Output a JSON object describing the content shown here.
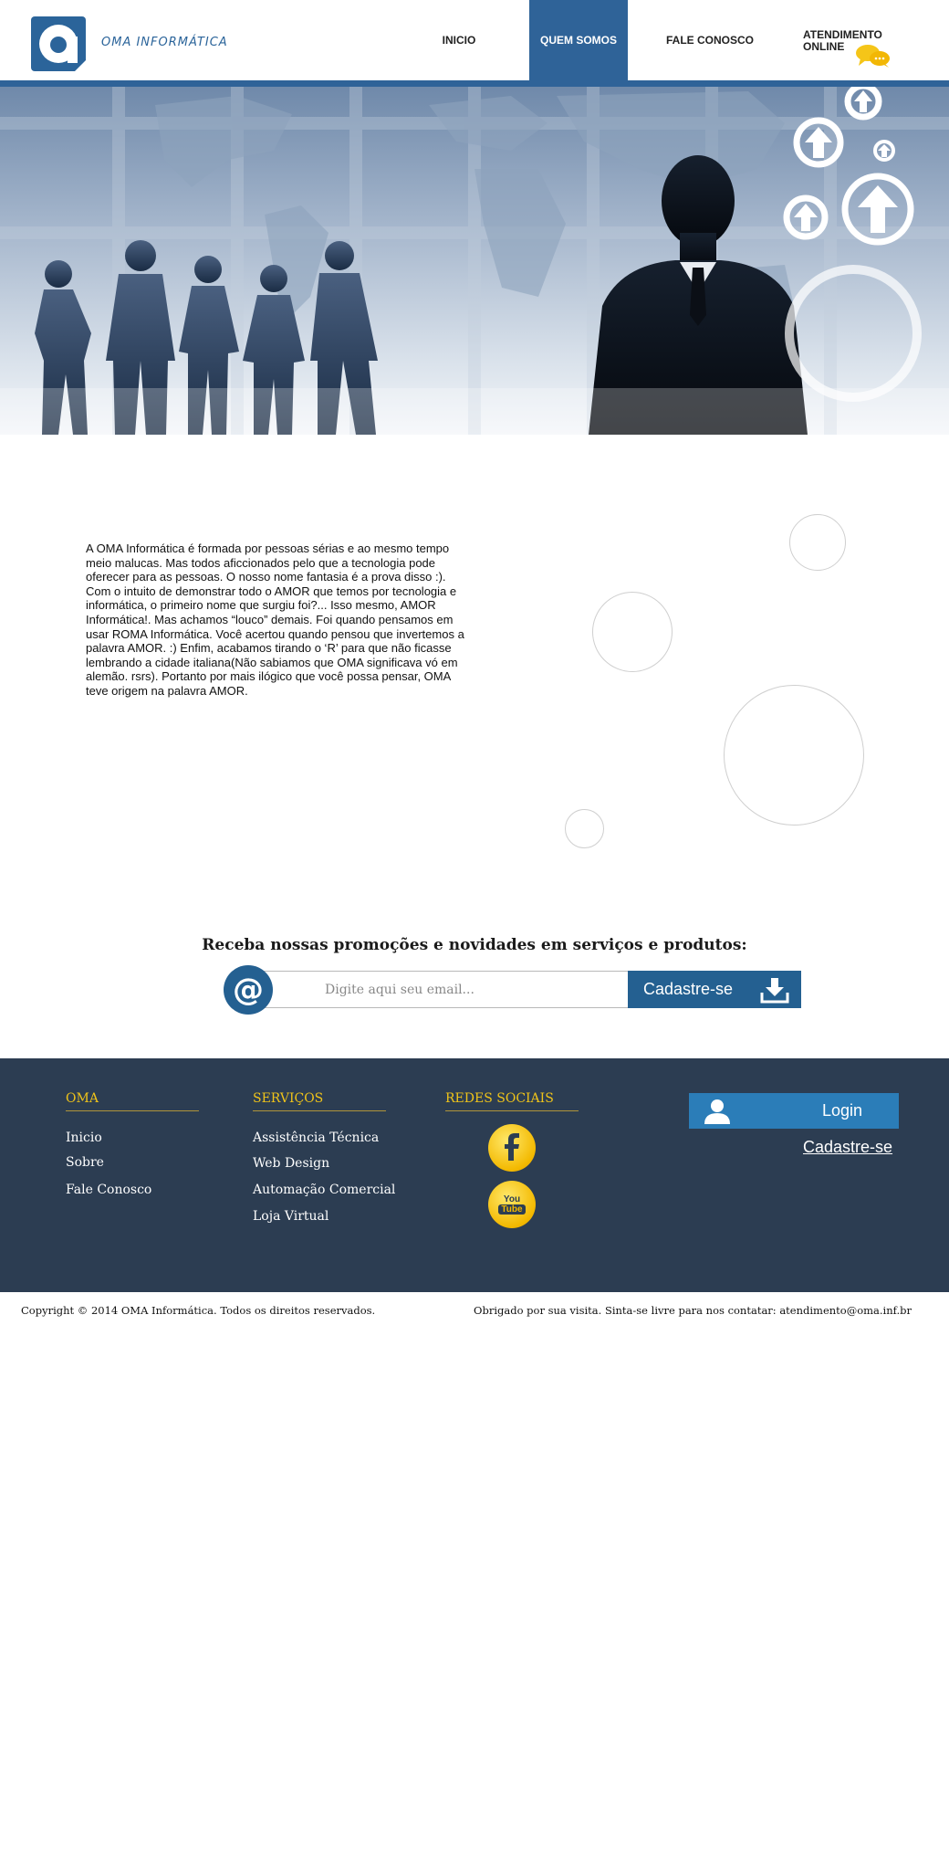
{
  "header": {
    "brand": "OMA INFORMÁTICA",
    "nav": {
      "inicio": "INICIO",
      "quem_somos": "QUEM SOMOS",
      "fale_conosco": "FALE CONOSCO",
      "atendimento_line1": "ATENDIMENTO",
      "atendimento_line2": "ONLINE"
    },
    "active_item": "QUEM SOMOS"
  },
  "about": {
    "text": "A OMA Informática é formada por pessoas sérias e ao mesmo tempo meio malucas. Mas todos aficcionados pelo que a tecnologia pode oferecer para as pessoas. O nosso nome fantasia é a prova disso :). Com o intuito de demonstrar todo o AMOR que temos por tecnologia e informática, o primeiro nome que surgiu foi?... Isso mesmo, AMOR Informática!. Mas achamos “louco” demais. Foi quando pensamos em usar ROMA Informática. Você acertou quando pensou que invertemos a palavra AMOR. :) Enfim, acabamos tirando o ‘R’ para que não ficasse lembrando a cidade italiana(Não sabiamos que OMA significava vó em alemão. rsrs). Portanto por mais ilógico que você possa pensar, OMA teve origem na palavra AMOR."
  },
  "newsletter": {
    "title": "Receba nossas promoções e novidades em serviços e produtos:",
    "at_symbol": "@",
    "placeholder": "Digite aqui seu email...",
    "button": "Cadastre-se"
  },
  "footer": {
    "oma": {
      "heading": "OMA",
      "links": [
        "Inicio",
        "Sobre",
        "Fale Conosco"
      ]
    },
    "servicos": {
      "heading": "SERVIÇOS",
      "links": [
        "Assistência Técnica",
        "Web Design",
        "Automação Comercial",
        "Loja Virtual"
      ]
    },
    "redes": {
      "heading": "REDES SOCIAIS",
      "icons": [
        "facebook-icon",
        "youtube-icon"
      ],
      "youtube_text": [
        "You",
        "Tube"
      ]
    },
    "login_button": "Login",
    "signup_link": "Cadastre-se"
  },
  "bottom": {
    "copyright": "Copyright © 2014 OMA Informática. Todos os direitos reservados.",
    "thanks": "Obrigado por sua visita. Sinta-se livre para nos contatar: atendimento@oma.inf.br"
  },
  "colors": {
    "brand_blue": "#2f6398",
    "footer_bg": "#2c3d52",
    "footer_heading": "#f0c419",
    "login_blue": "#2b7db8",
    "social_yellow": "#f3b900"
  }
}
